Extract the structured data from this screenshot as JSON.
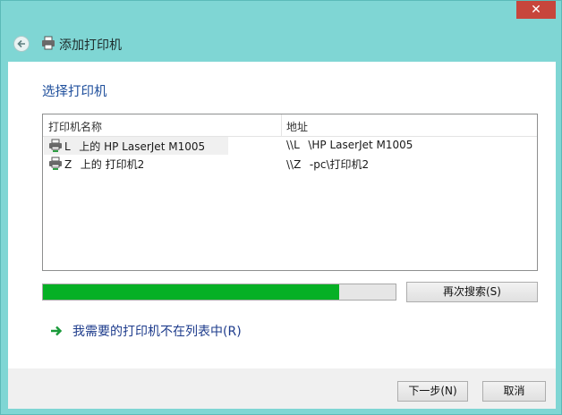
{
  "window": {
    "close_glyph": "✕"
  },
  "header": {
    "title": "添加打印机",
    "icon": "printer-icon",
    "back_icon": "back-arrow-icon"
  },
  "main": {
    "title": "选择打印机",
    "columns": [
      "打印机名称",
      "地址"
    ],
    "printers": [
      {
        "name": "L    上的 HP LaserJet M1005",
        "address": "\\\\L    \\HP LaserJet M1005"
      },
      {
        "name": "Z    上的 打印机2",
        "address": "\\\\Z    -pc\\打印机2"
      }
    ],
    "progress": 0.84,
    "progress_color": "#06b025",
    "rescan_label": "再次搜索(S)",
    "missing_link": "我需要的打印机不在列表中(R)"
  },
  "footer": {
    "next_label": "下一步(N)",
    "cancel_label": "取消"
  }
}
